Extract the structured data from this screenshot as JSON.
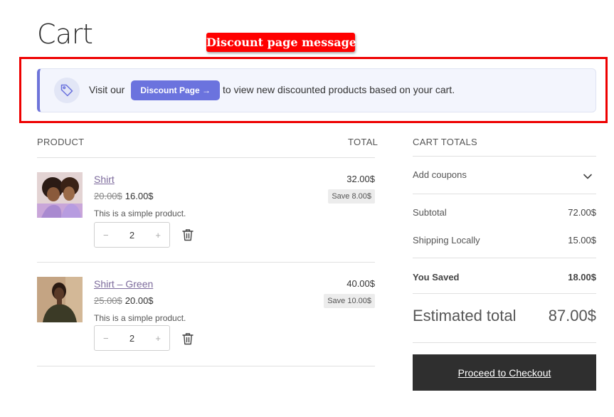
{
  "page": {
    "title": "Cart"
  },
  "annotation": {
    "label": "Discount page message"
  },
  "notice": {
    "text_before": "Visit our",
    "button_label": "Discount Page →",
    "text_after": "to view new discounted products based on your cart."
  },
  "table": {
    "product_header": "PRODUCT",
    "total_header": "TOTAL"
  },
  "items": [
    {
      "name": "Shirt",
      "old_price": "20.00$",
      "price": "16.00$",
      "description": "This is a simple product.",
      "quantity": "2",
      "total": "32.00$",
      "save": "Save 8.00$"
    },
    {
      "name": "Shirt – Green",
      "old_price": "25.00$",
      "price": "20.00$",
      "description": "This is a simple product.",
      "quantity": "2",
      "total": "40.00$",
      "save": "Save 10.00$"
    }
  ],
  "qty_controls": {
    "minus": "−",
    "plus": "+"
  },
  "totals": {
    "header": "CART TOTALS",
    "coupons_label": "Add coupons",
    "subtotal_label": "Subtotal",
    "subtotal_value": "72.00$",
    "shipping_label": "Shipping Locally",
    "shipping_value": "15.00$",
    "saved_label": "You Saved",
    "saved_value": "18.00$",
    "estimated_label": "Estimated total",
    "estimated_value": "87.00$",
    "checkout_label": "Proceed to Checkout"
  },
  "colors": {
    "accent": "#6b73de",
    "annotation": "#ff0000",
    "checkout_bg": "#2f2f2f"
  }
}
